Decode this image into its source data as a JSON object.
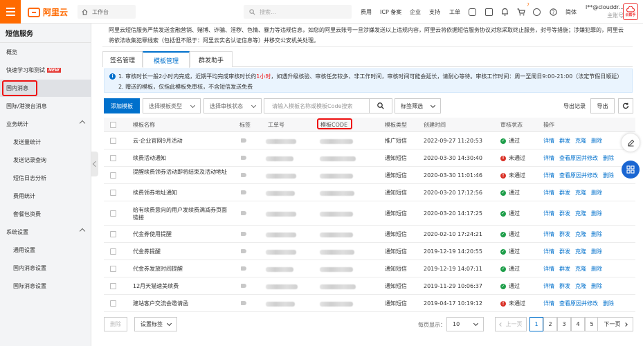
{
  "topbar": {
    "logo_text": "阿里云",
    "workbench": "工作台",
    "search_placeholder": "搜索...",
    "links": [
      "费用",
      "ICP 备案",
      "企业",
      "支持",
      "工单"
    ],
    "cart_badge": "7",
    "language": "简体",
    "account_name": "l**@clouddr...",
    "account_role": "主账号",
    "avatar_text": "云帮手"
  },
  "sidebar": {
    "title": "短信服务",
    "items": [
      {
        "label": "概览"
      },
      {
        "label": "快速学习和测试",
        "badge": "NEW"
      },
      {
        "label": "国内消息"
      },
      {
        "label": "国际/港澳台消息"
      },
      {
        "label": "业务统计"
      },
      {
        "label": "发送量统计"
      },
      {
        "label": "发送记录查询"
      },
      {
        "label": "短信日志分析"
      },
      {
        "label": "费用统计"
      },
      {
        "label": "套餐包资费"
      },
      {
        "label": "系统设置"
      },
      {
        "label": "通用设置"
      },
      {
        "label": "国内消息设置"
      },
      {
        "label": "国际消息设置"
      }
    ]
  },
  "notice": "阿里云短信服务严禁发送金融营销、赌博、诈骗、淫秽、色情、暴力等违规信息，如您的阿里云账号一旦涉嫌发送以上违规内容，阿里云将依据短信服务协议对您采取终止服务，封号等措施；涉嫌犯罪的，阿里云将依法收集犯罪线索（包括但不限于：阿里云实名认证信息等）并移交公安机关处理。",
  "tabs": [
    "签名管理",
    "模板管理",
    "群发助手"
  ],
  "info": {
    "line1_prefix": "1. 审核时长一般2小时内完成，近期平均完成审核时长约",
    "line1_highlight": "1小时",
    "line1_suffix": "，如遇升级核验、审核任务较多、非工作时间，审核时间可能会延长，请耐心等待。审核工作时间：周一至周日9:00-21:00（法定节假日顺延）",
    "line2": "2. 赠送的模板，仅指此模板免审核，不含短信发送免费"
  },
  "toolbar": {
    "add_button": "添加模板",
    "type_select": "选择模板类型",
    "status_select": "选择审核状态",
    "search_placeholder": "请输入模板名称或模板Code搜索",
    "tag_filter": "标签筛选",
    "export_records": "导出记录",
    "export_button": "导出"
  },
  "table": {
    "headers": [
      "模板名称",
      "标签",
      "工单号",
      "模板CODE",
      "模板类型",
      "创建时间",
      "审核状态",
      "操作"
    ],
    "rows": [
      {
        "name": "云·企业官网9月活动",
        "type": "推广短信",
        "created": "2022-09-27 11:20:53",
        "status": "通过",
        "ok": true,
        "ops": [
          "详情",
          "群发",
          "克隆",
          "删除"
        ]
      },
      {
        "name": "续费活动通知",
        "type": "通知短信",
        "created": "2020-03-30 14:30:40",
        "status": "未通过",
        "ok": false,
        "ops": [
          "详情",
          "查看原因并修改",
          "删除"
        ]
      },
      {
        "name": "提醒续费领券活动即将结束及活动地址",
        "type": "通知短信",
        "created": "2020-03-30 11:01:46",
        "status": "未通过",
        "ok": false,
        "ops": [
          "详情",
          "查看原因并修改",
          "删除"
        ]
      },
      {
        "name": "续费领券地址通知",
        "type": "通知短信",
        "created": "2020-03-20 17:12:56",
        "status": "通过",
        "ok": true,
        "ops": [
          "详情",
          "群发",
          "克隆",
          "删除"
        ]
      },
      {
        "name": "给有续费意向的用户发续费满减券页面链接",
        "type": "通知短信",
        "created": "2020-03-20 14:17:25",
        "status": "通过",
        "ok": true,
        "ops": [
          "详情",
          "群发",
          "克隆",
          "删除"
        ]
      },
      {
        "name": "代金券使用提醒",
        "type": "通知短信",
        "created": "2020-02-10 17:24:21",
        "status": "通过",
        "ok": true,
        "ops": [
          "详情",
          "群发",
          "克隆",
          "删除"
        ]
      },
      {
        "name": "代金券提醒",
        "type": "通知短信",
        "created": "2019-12-19 14:20:55",
        "status": "通过",
        "ok": true,
        "ops": [
          "详情",
          "群发",
          "克隆",
          "删除"
        ]
      },
      {
        "name": "代金券发放时间提醒",
        "type": "通知短信",
        "created": "2019-12-19 14:07:11",
        "status": "通过",
        "ok": true,
        "ops": [
          "详情",
          "群发",
          "克隆",
          "删除"
        ]
      },
      {
        "name": "12月天猫速美续费",
        "type": "通知短信",
        "created": "2019-11-29 10:06:37",
        "status": "通过",
        "ok": true,
        "ops": [
          "详情",
          "群发",
          "克隆",
          "删除"
        ]
      },
      {
        "name": "建站客户交流会邀请函",
        "type": "通知短信",
        "created": "2019-04-17 10:19:12",
        "status": "未通过",
        "ok": false,
        "ops": [
          "详情",
          "查看原因并修改",
          "删除"
        ]
      }
    ]
  },
  "footer": {
    "delete_button": "删除",
    "tag_settings": "设置标签",
    "page_size_label": "每页显示：",
    "page_size": "10",
    "prev": "上一页",
    "next": "下一页",
    "pages": [
      "1",
      "2",
      "3",
      "4",
      "5"
    ]
  },
  "colors": {
    "accent": "#ff6a00",
    "primary": "#0070cc",
    "success": "#1e9e4a",
    "error": "#d93026",
    "highlight_box": "#e11111"
  }
}
